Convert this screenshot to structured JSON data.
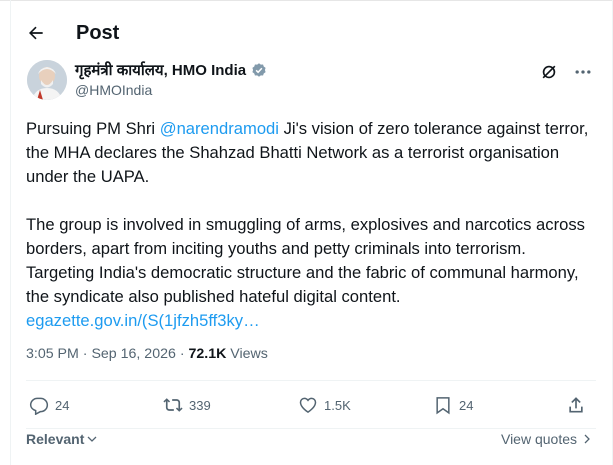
{
  "header": {
    "title": "Post"
  },
  "author": {
    "name": "गृहमंत्री कार्यालय, HMO India",
    "handle": "@HMOIndia"
  },
  "post": {
    "p1_a": "Pursuing PM Shri ",
    "mention": "@narendramodi",
    "p1_b": " Ji's vision of zero tolerance against terror, the MHA declares the Shahzad Bhatti Network as a terrorist organisation under the UAPA.",
    "p2": "The group is involved in smuggling of arms, explosives and narcotics across borders, apart from inciting youths and petty criminals into terrorism. Targeting India's democratic structure and the fabric of communal harmony, the syndicate also published hateful digital content.",
    "link": "egazette.gov.in/(S(1jfzh5ff3ky…"
  },
  "meta": {
    "time": "3:05 PM",
    "sep": " · ",
    "date": "Sep 16, 2026",
    "views_count": "72.1K",
    "views_label": " Views"
  },
  "actions": {
    "replies": "24",
    "reposts": "339",
    "likes": "1.5K",
    "bookmarks": "24"
  },
  "footer": {
    "sort_label": "Relevant",
    "view_quotes": "View quotes"
  },
  "colors": {
    "link": "#1d9bf0",
    "verified": "#829aab",
    "muted": "#536471"
  },
  "icons": [
    "back-arrow-icon",
    "verified-badge-icon",
    "grok-icon",
    "more-icon",
    "reply-icon",
    "repost-icon",
    "like-icon",
    "bookmark-icon",
    "share-icon",
    "chevron-down-icon",
    "chevron-right-icon"
  ]
}
